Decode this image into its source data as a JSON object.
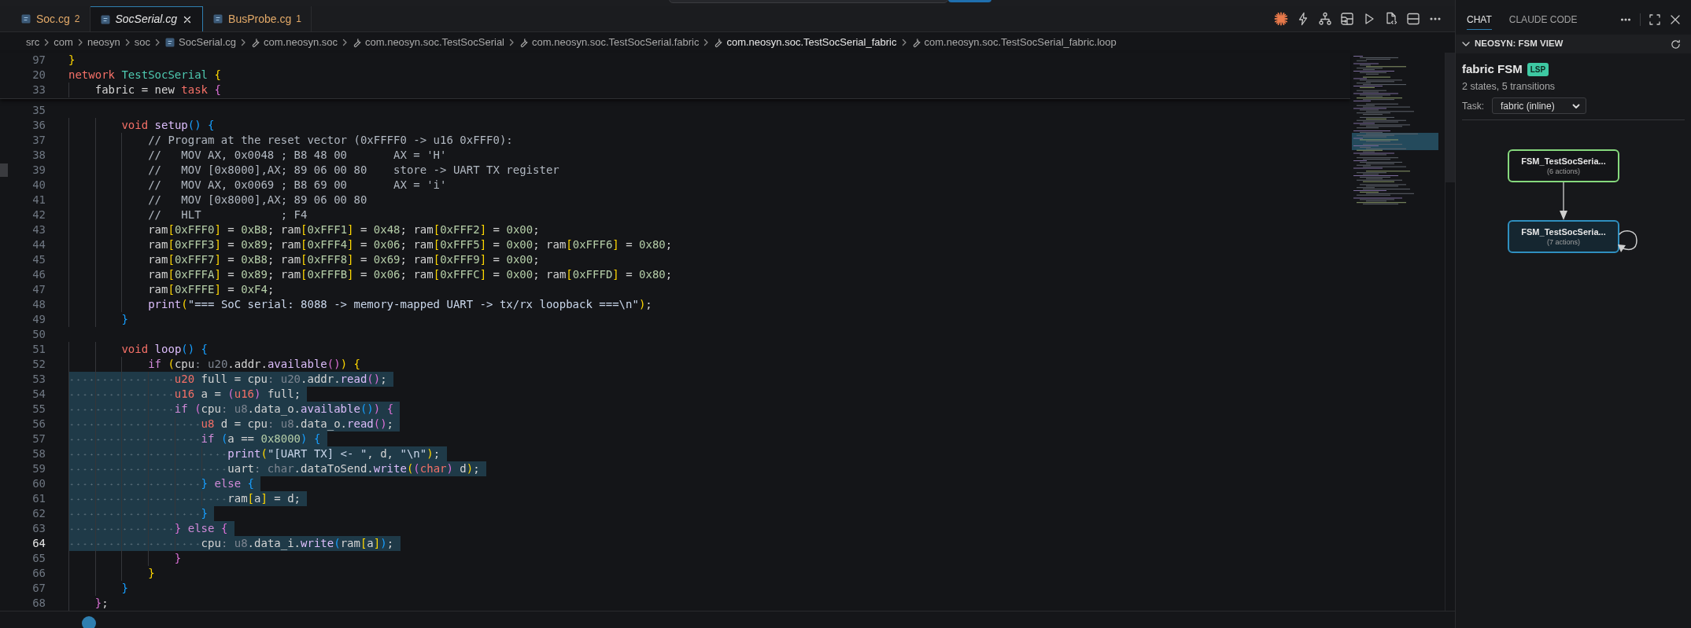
{
  "title_bar": {
    "search_field": true,
    "button": true
  },
  "editor_tabs": [
    {
      "label": "Soc.cg",
      "badge": "2",
      "selected": false,
      "preview": false,
      "has_problems": true
    },
    {
      "label": "SocSerial.cg",
      "selected": true,
      "preview": true,
      "has_problems": false
    },
    {
      "label": "BusProbe.cg",
      "badge": "1",
      "selected": false,
      "preview": false,
      "has_problems": true
    }
  ],
  "breadcrumbs": [
    {
      "label": "src",
      "kind": "folder",
      "active": false
    },
    {
      "label": "com",
      "kind": "folder",
      "active": false
    },
    {
      "label": "neosyn",
      "kind": "folder",
      "active": false
    },
    {
      "label": "soc",
      "kind": "folder",
      "active": false
    },
    {
      "label": "SocSerial.cg",
      "kind": "file",
      "active": false
    },
    {
      "label": "com.neosyn.soc",
      "kind": "symbol",
      "active": false
    },
    {
      "label": "com.neosyn.soc.TestSocSerial",
      "kind": "symbol",
      "active": false
    },
    {
      "label": "com.neosyn.soc.TestSocSerial.fabric",
      "kind": "symbol",
      "active": false
    },
    {
      "label": "com.neosyn.soc.TestSocSerial_fabric",
      "kind": "symbol",
      "active": true
    },
    {
      "label": "com.neosyn.soc.TestSocSerial_fabric.loop",
      "kind": "symbol",
      "active": false
    }
  ],
  "sticky_lines": [
    {
      "number": "97",
      "tokens": [
        {
          "text": "}",
          "kind": "p1"
        }
      ]
    },
    {
      "number": "20",
      "tokens": [
        {
          "text": "network ",
          "kind": "kw"
        },
        {
          "text": "TestSocSerial ",
          "kind": "type"
        },
        {
          "text": "{",
          "kind": "p1"
        }
      ]
    },
    {
      "number": "33",
      "tokens": [
        {
          "text": "    fabric = new ",
          "kind": "plain"
        },
        {
          "text": "task ",
          "kind": "kw"
        },
        {
          "text": "{",
          "kind": "p2"
        }
      ]
    }
  ],
  "lines": [
    {
      "number": "35",
      "selected": false,
      "current": false,
      "marked": false
    },
    {
      "number": "36",
      "selected": false,
      "current": false,
      "marked": false,
      "tokens": [
        {
          "text": "        void ",
          "kind": "kw"
        },
        {
          "text": "setup",
          "kind": "fn"
        },
        {
          "text": "() ",
          "kind": "p3"
        },
        {
          "text": "{",
          "kind": "p3"
        }
      ]
    },
    {
      "number": "37",
      "selected": false,
      "current": false,
      "marked": false,
      "tokens": [
        {
          "text": "            // Program at the reset vector (0xFFFF0 -> u16 0xFFF0):",
          "kind": "comment"
        }
      ]
    },
    {
      "number": "38",
      "selected": false,
      "current": false,
      "marked": false,
      "tokens": [
        {
          "text": "            //   MOV AX, 0x0048 ; B8 48 00       AX = 'H'",
          "kind": "comment"
        }
      ]
    },
    {
      "number": "39",
      "selected": false,
      "current": false,
      "marked": true,
      "tokens": [
        {
          "text": "            //   MOV [0x8000],AX; 89 06 00 80    store -> UART TX register",
          "kind": "comment"
        }
      ]
    },
    {
      "number": "40",
      "selected": false,
      "current": false,
      "marked": false,
      "tokens": [
        {
          "text": "            //   MOV AX, 0x0069 ; B8 69 00       AX = 'i'",
          "kind": "comment"
        }
      ]
    },
    {
      "number": "41",
      "selected": false,
      "current": false,
      "marked": false,
      "tokens": [
        {
          "text": "            //   MOV [0x8000],AX; 89 06 00 80",
          "kind": "comment"
        }
      ]
    },
    {
      "number": "42",
      "selected": false,
      "current": false,
      "marked": false,
      "tokens": [
        {
          "text": "            //   HLT            ; F4",
          "kind": "comment"
        }
      ]
    },
    {
      "number": "43",
      "selected": false,
      "current": false,
      "marked": false,
      "tokens": [
        {
          "text": "            ram",
          "kind": "plain"
        },
        {
          "text": "[",
          "kind": "p1"
        },
        {
          "text": "0xFFF0",
          "kind": "num"
        },
        {
          "text": "]",
          "kind": "p1"
        },
        {
          "text": " = ",
          "kind": "plain"
        },
        {
          "text": "0xB8",
          "kind": "num"
        },
        {
          "text": "; ram",
          "kind": "plain"
        },
        {
          "text": "[",
          "kind": "p1"
        },
        {
          "text": "0xFFF1",
          "kind": "num"
        },
        {
          "text": "]",
          "kind": "p1"
        },
        {
          "text": " = ",
          "kind": "plain"
        },
        {
          "text": "0x48",
          "kind": "num"
        },
        {
          "text": "; ram",
          "kind": "plain"
        },
        {
          "text": "[",
          "kind": "p1"
        },
        {
          "text": "0xFFF2",
          "kind": "num"
        },
        {
          "text": "]",
          "kind": "p1"
        },
        {
          "text": " = ",
          "kind": "plain"
        },
        {
          "text": "0x00",
          "kind": "num"
        },
        {
          "text": ";",
          "kind": "plain"
        }
      ]
    },
    {
      "number": "44",
      "selected": false,
      "current": false,
      "marked": false,
      "tokens": [
        {
          "text": "            ram",
          "kind": "plain"
        },
        {
          "text": "[",
          "kind": "p1"
        },
        {
          "text": "0xFFF3",
          "kind": "num"
        },
        {
          "text": "]",
          "kind": "p1"
        },
        {
          "text": " = ",
          "kind": "plain"
        },
        {
          "text": "0x89",
          "kind": "num"
        },
        {
          "text": "; ram",
          "kind": "plain"
        },
        {
          "text": "[",
          "kind": "p1"
        },
        {
          "text": "0xFFF4",
          "kind": "num"
        },
        {
          "text": "]",
          "kind": "p1"
        },
        {
          "text": " = ",
          "kind": "plain"
        },
        {
          "text": "0x06",
          "kind": "num"
        },
        {
          "text": "; ram",
          "kind": "plain"
        },
        {
          "text": "[",
          "kind": "p1"
        },
        {
          "text": "0xFFF5",
          "kind": "num"
        },
        {
          "text": "]",
          "kind": "p1"
        },
        {
          "text": " = ",
          "kind": "plain"
        },
        {
          "text": "0x00",
          "kind": "num"
        },
        {
          "text": "; ram",
          "kind": "plain"
        },
        {
          "text": "[",
          "kind": "p1"
        },
        {
          "text": "0xFFF6",
          "kind": "num"
        },
        {
          "text": "]",
          "kind": "p1"
        },
        {
          "text": " = ",
          "kind": "plain"
        },
        {
          "text": "0x80",
          "kind": "num"
        },
        {
          "text": ";",
          "kind": "plain"
        }
      ]
    },
    {
      "number": "45",
      "selected": false,
      "current": false,
      "marked": false,
      "tokens": [
        {
          "text": "            ram",
          "kind": "plain"
        },
        {
          "text": "[",
          "kind": "p1"
        },
        {
          "text": "0xFFF7",
          "kind": "num"
        },
        {
          "text": "]",
          "kind": "p1"
        },
        {
          "text": " = ",
          "kind": "plain"
        },
        {
          "text": "0xB8",
          "kind": "num"
        },
        {
          "text": "; ram",
          "kind": "plain"
        },
        {
          "text": "[",
          "kind": "p1"
        },
        {
          "text": "0xFFF8",
          "kind": "num"
        },
        {
          "text": "]",
          "kind": "p1"
        },
        {
          "text": " = ",
          "kind": "plain"
        },
        {
          "text": "0x69",
          "kind": "num"
        },
        {
          "text": "; ram",
          "kind": "plain"
        },
        {
          "text": "[",
          "kind": "p1"
        },
        {
          "text": "0xFFF9",
          "kind": "num"
        },
        {
          "text": "]",
          "kind": "p1"
        },
        {
          "text": " = ",
          "kind": "plain"
        },
        {
          "text": "0x00",
          "kind": "num"
        },
        {
          "text": ";",
          "kind": "plain"
        }
      ]
    },
    {
      "number": "46",
      "selected": false,
      "current": false,
      "marked": false,
      "tokens": [
        {
          "text": "            ram",
          "kind": "plain"
        },
        {
          "text": "[",
          "kind": "p1"
        },
        {
          "text": "0xFFFA",
          "kind": "num"
        },
        {
          "text": "]",
          "kind": "p1"
        },
        {
          "text": " = ",
          "kind": "plain"
        },
        {
          "text": "0x89",
          "kind": "num"
        },
        {
          "text": "; ram",
          "kind": "plain"
        },
        {
          "text": "[",
          "kind": "p1"
        },
        {
          "text": "0xFFFB",
          "kind": "num"
        },
        {
          "text": "]",
          "kind": "p1"
        },
        {
          "text": " = ",
          "kind": "plain"
        },
        {
          "text": "0x06",
          "kind": "num"
        },
        {
          "text": "; ram",
          "kind": "plain"
        },
        {
          "text": "[",
          "kind": "p1"
        },
        {
          "text": "0xFFFC",
          "kind": "num"
        },
        {
          "text": "]",
          "kind": "p1"
        },
        {
          "text": " = ",
          "kind": "plain"
        },
        {
          "text": "0x00",
          "kind": "num"
        },
        {
          "text": "; ram",
          "kind": "plain"
        },
        {
          "text": "[",
          "kind": "p1"
        },
        {
          "text": "0xFFFD",
          "kind": "num"
        },
        {
          "text": "]",
          "kind": "p1"
        },
        {
          "text": " = ",
          "kind": "plain"
        },
        {
          "text": "0x80",
          "kind": "num"
        },
        {
          "text": ";",
          "kind": "plain"
        }
      ]
    },
    {
      "number": "47",
      "selected": false,
      "current": false,
      "marked": false,
      "tokens": [
        {
          "text": "            ram",
          "kind": "plain"
        },
        {
          "text": "[",
          "kind": "p1"
        },
        {
          "text": "0xFFFE",
          "kind": "num"
        },
        {
          "text": "]",
          "kind": "p1"
        },
        {
          "text": " = ",
          "kind": "plain"
        },
        {
          "text": "0xF4",
          "kind": "num"
        },
        {
          "text": ";",
          "kind": "plain"
        }
      ]
    },
    {
      "number": "48",
      "selected": false,
      "current": false,
      "marked": false,
      "tokens": [
        {
          "text": "            print",
          "kind": "fn"
        },
        {
          "text": "(",
          "kind": "p1"
        },
        {
          "text": "\"=== SoC serial: 8088 -> memory-mapped UART -> tx/rx loopback ===\\n\"",
          "kind": "str"
        },
        {
          "text": ")",
          "kind": "p1"
        },
        {
          "text": ";",
          "kind": "plain"
        }
      ]
    },
    {
      "number": "49",
      "selected": false,
      "current": false,
      "marked": false,
      "tokens": [
        {
          "text": "        }",
          "kind": "p3"
        }
      ]
    },
    {
      "number": "50",
      "selected": false,
      "current": false,
      "marked": false
    },
    {
      "number": "51",
      "selected": false,
      "current": false,
      "marked": false,
      "tokens": [
        {
          "text": "        void ",
          "kind": "kw"
        },
        {
          "text": "loop",
          "kind": "fn"
        },
        {
          "text": "() ",
          "kind": "p3"
        },
        {
          "text": "{",
          "kind": "p3"
        }
      ]
    },
    {
      "number": "52",
      "selected": false,
      "current": false,
      "marked": false,
      "tokens": [
        {
          "text": "            if ",
          "kind": "ctrl"
        },
        {
          "text": "(",
          "kind": "p1"
        },
        {
          "text": "cpu",
          "kind": "plain"
        },
        {
          "text": ": u20",
          "kind": "hint"
        },
        {
          "text": ".addr.",
          "kind": "plain"
        },
        {
          "text": "available",
          "kind": "fn"
        },
        {
          "text": "()",
          "kind": "p2"
        },
        {
          "text": ") ",
          "kind": "p1"
        },
        {
          "text": "{",
          "kind": "p1"
        }
      ]
    },
    {
      "number": "53",
      "selected": true,
      "current": false,
      "marked": false,
      "tokens": [
        {
          "text": "                u20",
          "kind": "kw"
        },
        {
          "text": " full = cpu",
          "kind": "plain"
        },
        {
          "text": ": u20",
          "kind": "hint"
        },
        {
          "text": ".addr.",
          "kind": "plain"
        },
        {
          "text": "read",
          "kind": "fn"
        },
        {
          "text": "()",
          "kind": "p2"
        },
        {
          "text": ";",
          "kind": "plain"
        }
      ]
    },
    {
      "number": "54",
      "selected": true,
      "current": false,
      "marked": false,
      "tokens": [
        {
          "text": "                u16",
          "kind": "kw"
        },
        {
          "text": " a = ",
          "kind": "plain"
        },
        {
          "text": "(",
          "kind": "p2"
        },
        {
          "text": "u16",
          "kind": "kw"
        },
        {
          "text": ")",
          "kind": "p2"
        },
        {
          "text": " full;",
          "kind": "plain"
        }
      ]
    },
    {
      "number": "55",
      "selected": true,
      "current": false,
      "marked": false,
      "tokens": [
        {
          "text": "                if ",
          "kind": "ctrl"
        },
        {
          "text": "(",
          "kind": "p2"
        },
        {
          "text": "cpu",
          "kind": "plain"
        },
        {
          "text": ": u8",
          "kind": "hint"
        },
        {
          "text": ".data_o.",
          "kind": "plain"
        },
        {
          "text": "available",
          "kind": "fn"
        },
        {
          "text": "()",
          "kind": "p3"
        },
        {
          "text": ") ",
          "kind": "p2"
        },
        {
          "text": "{",
          "kind": "p2"
        }
      ]
    },
    {
      "number": "56",
      "selected": true,
      "current": false,
      "marked": false,
      "tokens": [
        {
          "text": "                    u8",
          "kind": "kw"
        },
        {
          "text": " d = cpu",
          "kind": "plain"
        },
        {
          "text": ": u8",
          "kind": "hint"
        },
        {
          "text": ".data_o.",
          "kind": "plain"
        },
        {
          "text": "read",
          "kind": "fn"
        },
        {
          "text": "()",
          "kind": "p2"
        },
        {
          "text": ";",
          "kind": "plain"
        }
      ]
    },
    {
      "number": "57",
      "selected": true,
      "current": false,
      "marked": false,
      "tokens": [
        {
          "text": "                    if ",
          "kind": "ctrl"
        },
        {
          "text": "(",
          "kind": "p3"
        },
        {
          "text": "a == ",
          "kind": "plain"
        },
        {
          "text": "0x8000",
          "kind": "num"
        },
        {
          "text": ") ",
          "kind": "p3"
        },
        {
          "text": "{",
          "kind": "p3"
        }
      ]
    },
    {
      "number": "58",
      "selected": true,
      "current": false,
      "marked": false,
      "tokens": [
        {
          "text": "                        print",
          "kind": "fn"
        },
        {
          "text": "(",
          "kind": "p1"
        },
        {
          "text": "\"[UART TX] <- \"",
          "kind": "str"
        },
        {
          "text": ", d, ",
          "kind": "plain"
        },
        {
          "text": "\"\\n\"",
          "kind": "str"
        },
        {
          "text": ")",
          "kind": "p1"
        },
        {
          "text": ";",
          "kind": "plain"
        }
      ]
    },
    {
      "number": "59",
      "selected": true,
      "current": false,
      "marked": false,
      "tokens": [
        {
          "text": "                        uart",
          "kind": "plain"
        },
        {
          "text": ": char",
          "kind": "hint"
        },
        {
          "text": ".dataToSend.",
          "kind": "plain"
        },
        {
          "text": "write",
          "kind": "fn"
        },
        {
          "text": "(",
          "kind": "p1"
        },
        {
          "text": "(",
          "kind": "p2"
        },
        {
          "text": "char",
          "kind": "kw"
        },
        {
          "text": ")",
          "kind": "p2"
        },
        {
          "text": " d",
          "kind": "plain"
        },
        {
          "text": ")",
          "kind": "p1"
        },
        {
          "text": ";",
          "kind": "plain"
        }
      ]
    },
    {
      "number": "60",
      "selected": true,
      "current": false,
      "marked": false,
      "tokens": [
        {
          "text": "                    } ",
          "kind": "p3"
        },
        {
          "text": "else ",
          "kind": "ctrl"
        },
        {
          "text": "{",
          "kind": "p3"
        }
      ]
    },
    {
      "number": "61",
      "selected": true,
      "current": false,
      "marked": false,
      "tokens": [
        {
          "text": "                        ram",
          "kind": "plain"
        },
        {
          "text": "[",
          "kind": "p1"
        },
        {
          "text": "a",
          "kind": "plain"
        },
        {
          "text": "]",
          "kind": "p1"
        },
        {
          "text": " = d;",
          "kind": "plain"
        }
      ]
    },
    {
      "number": "62",
      "selected": true,
      "current": false,
      "marked": false,
      "tokens": [
        {
          "text": "                    }",
          "kind": "p3"
        }
      ]
    },
    {
      "number": "63",
      "selected": true,
      "current": false,
      "marked": false,
      "tokens": [
        {
          "text": "                } ",
          "kind": "p2"
        },
        {
          "text": "else ",
          "kind": "ctrl"
        },
        {
          "text": "{",
          "kind": "p2"
        }
      ]
    },
    {
      "number": "64",
      "selected": true,
      "current": true,
      "marked": false,
      "tokens": [
        {
          "text": "                    cpu",
          "kind": "plain"
        },
        {
          "text": ": u8",
          "kind": "hint"
        },
        {
          "text": ".data_i.",
          "kind": "plain"
        },
        {
          "text": "write",
          "kind": "fn"
        },
        {
          "text": "(",
          "kind": "p3"
        },
        {
          "text": "ram",
          "kind": "plain"
        },
        {
          "text": "[",
          "kind": "p1"
        },
        {
          "text": "a",
          "kind": "plain"
        },
        {
          "text": "]",
          "kind": "p1"
        },
        {
          "text": ")",
          "kind": "p3"
        },
        {
          "text": ";",
          "kind": "plain"
        }
      ]
    },
    {
      "number": "65",
      "selected": false,
      "current": false,
      "marked": false,
      "tokens": [
        {
          "text": "                }",
          "kind": "p2"
        }
      ]
    },
    {
      "number": "66",
      "selected": false,
      "current": false,
      "marked": false,
      "tokens": [
        {
          "text": "            }",
          "kind": "p1"
        }
      ]
    },
    {
      "number": "67",
      "selected": false,
      "current": false,
      "marked": false,
      "tokens": [
        {
          "text": "        }",
          "kind": "p3"
        }
      ]
    },
    {
      "number": "68",
      "selected": false,
      "current": false,
      "marked": false,
      "tokens": [
        {
          "text": "    }",
          "kind": "p2"
        },
        {
          "text": ";",
          "kind": "plain"
        }
      ]
    }
  ],
  "side_panel": {
    "tabs": [
      {
        "label": "CHAT",
        "selected": true
      },
      {
        "label": "CLAUDE CODE",
        "selected": false
      }
    ],
    "section": {
      "title": "NEOSYN: FSM VIEW",
      "expanded": true
    },
    "heading": "fabric FSM",
    "badge": "LSP",
    "summary": "2 states, 5 transitions",
    "task": {
      "label": "Task:",
      "value": "fabric (inline)"
    },
    "states": [
      {
        "name": "FSM_TestSocSeria...",
        "actions": "(6 actions)",
        "kind": "initial"
      },
      {
        "name": "FSM_TestSocSeria...",
        "actions": "(7 actions)",
        "kind": "current"
      }
    ]
  }
}
